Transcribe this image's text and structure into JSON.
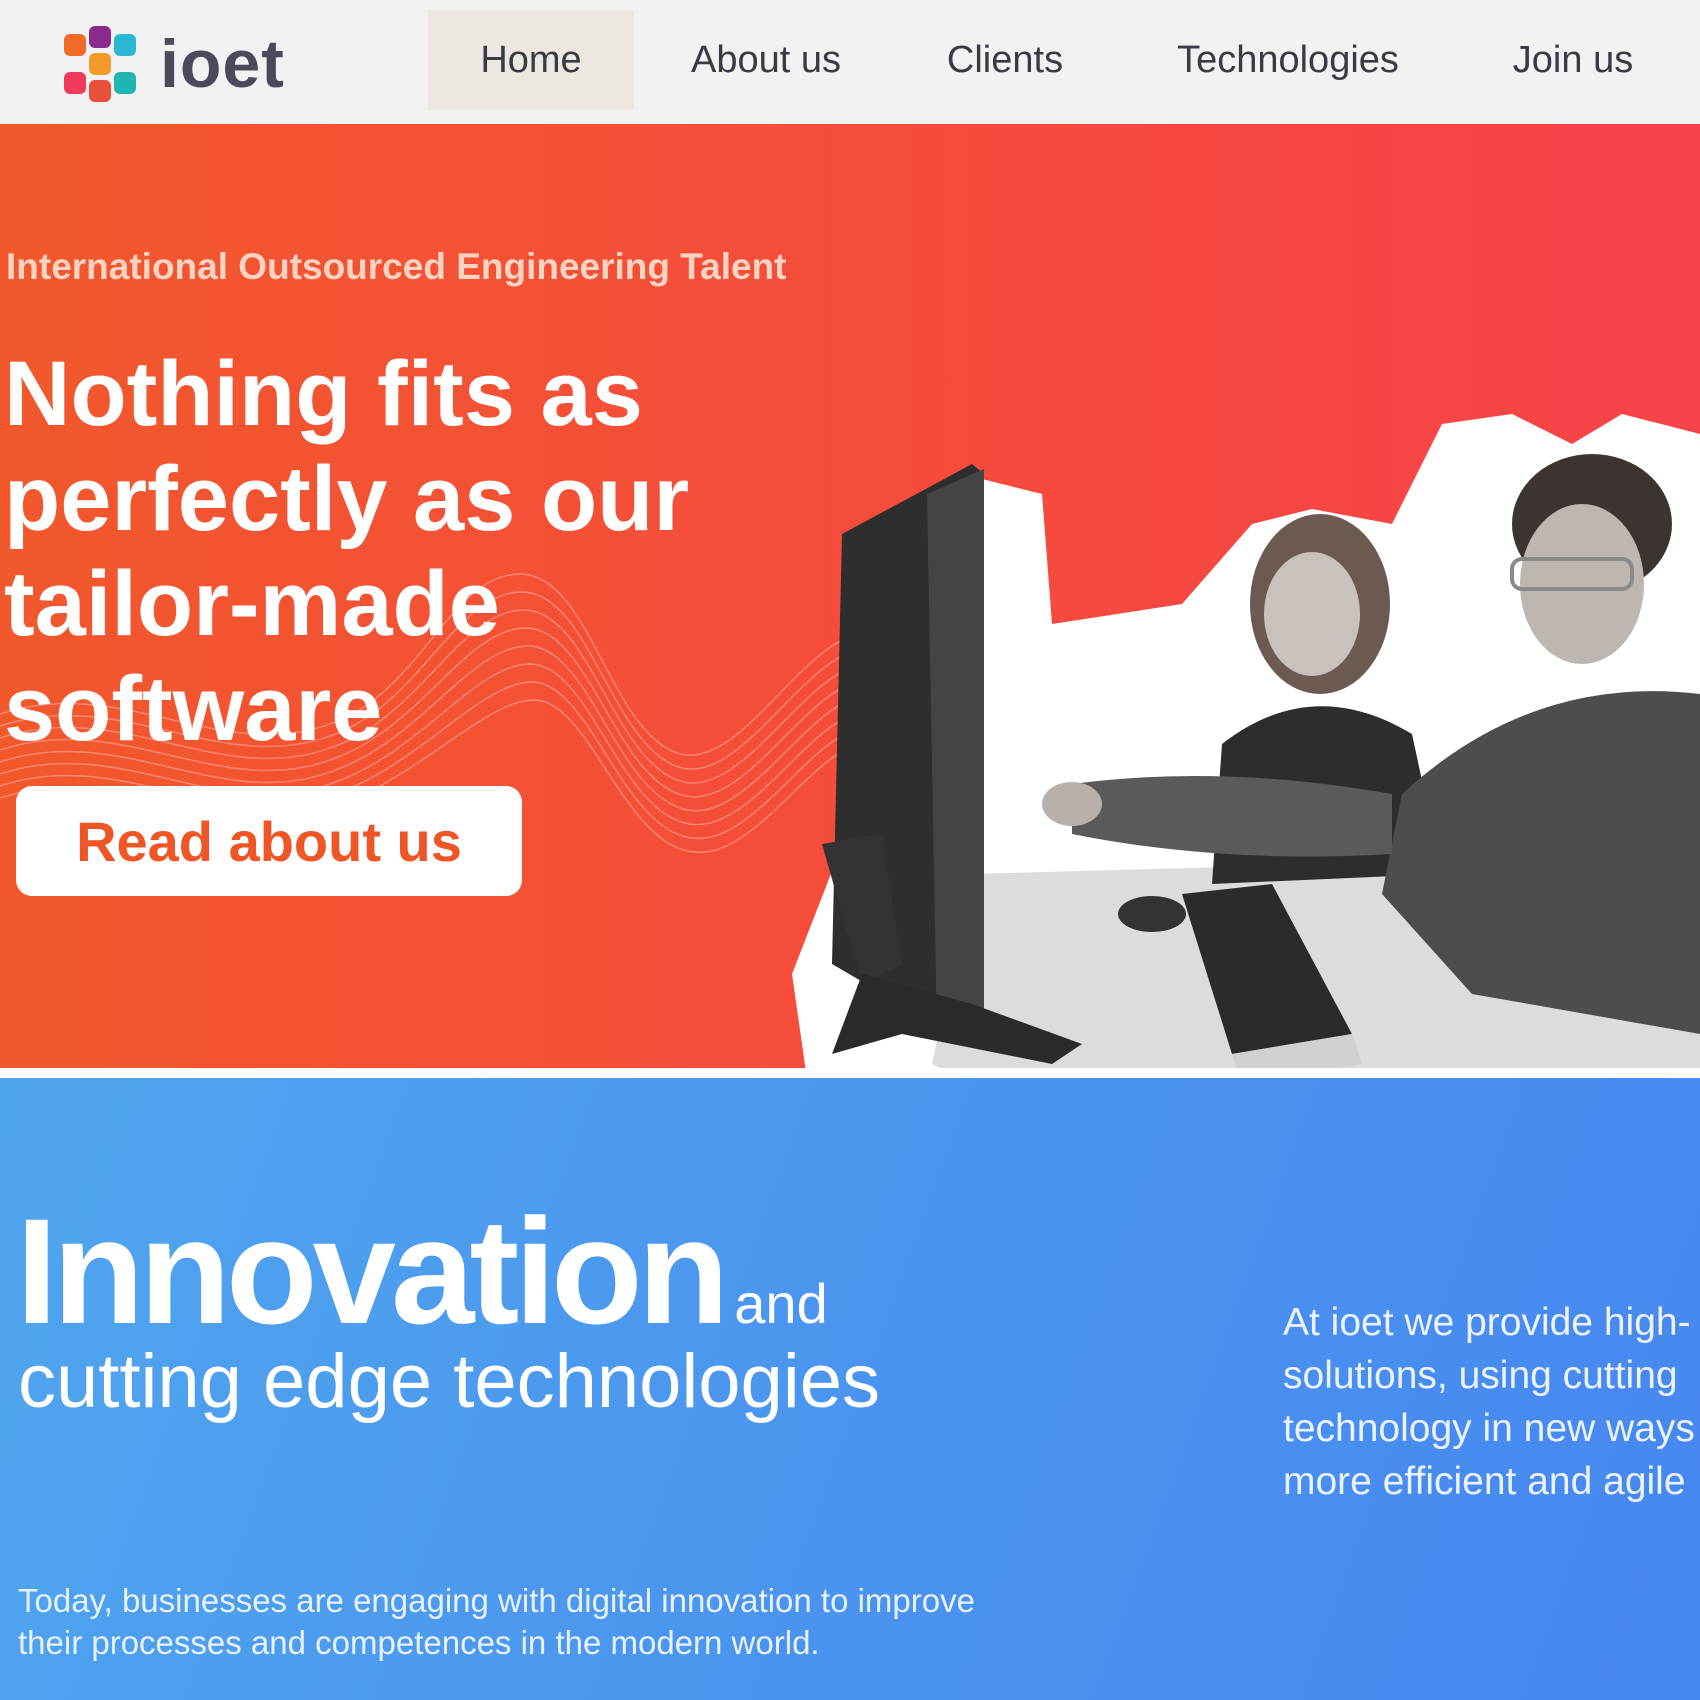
{
  "brand": {
    "name": "ioet"
  },
  "nav": {
    "items": [
      {
        "label": "Home",
        "active": true
      },
      {
        "label": "About us",
        "active": false
      },
      {
        "label": "Clients",
        "active": false
      },
      {
        "label": "Technologies",
        "active": false
      },
      {
        "label": "Join us",
        "active": false
      }
    ]
  },
  "hero": {
    "eyebrow": "International Outsourced Engineering Talent",
    "headline": "Nothing fits as perfectly as our tailor-made software",
    "cta_label": "Read about us",
    "image": "team-at-computer-photo"
  },
  "innovation": {
    "title_big": "Innovation",
    "title_and": "and",
    "title_sub": "cutting edge technologies",
    "right_lines": [
      "At ioet we provide high-",
      "solutions, using cutting",
      "technology in new ways",
      "more efficient and agile"
    ],
    "body": "Today, businesses are engaging with digital innovation to improve their processes and competences in the modern world."
  },
  "colors": {
    "hero_gradient_start": "#f1582c",
    "hero_gradient_end": "#f7434a",
    "innovation_gradient_start": "#50a6ee",
    "innovation_gradient_end": "#4787f0",
    "cta_text": "#ee5626",
    "nav_active_bg": "#ece8e1"
  }
}
